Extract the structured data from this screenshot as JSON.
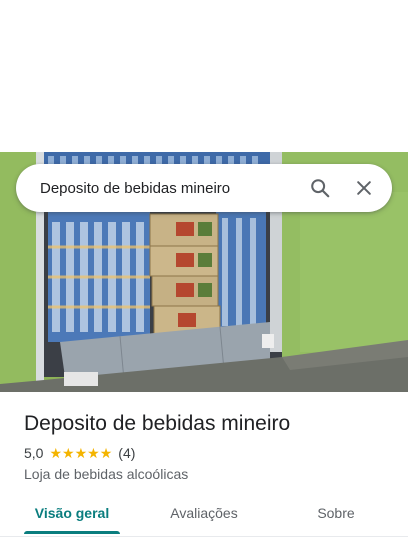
{
  "search": {
    "query": "Deposito de bebidas mineiro",
    "search_icon": "search-icon",
    "close_icon": "close-icon"
  },
  "place": {
    "name": "Deposito de bebidas mineiro",
    "rating": "5,0",
    "stars_value": 5,
    "stars_max": 5,
    "review_count": "(4)",
    "category": "Loja de bebidas alcoólicas",
    "photo": "storefront-photo"
  },
  "tabs": [
    {
      "label": "Visão geral",
      "active": true
    },
    {
      "label": "Avaliações",
      "active": false
    },
    {
      "label": "Sobre",
      "active": false
    }
  ],
  "colors": {
    "accent": "#0a7d7e",
    "star": "#f4b400",
    "wall": "#8fb95a"
  }
}
